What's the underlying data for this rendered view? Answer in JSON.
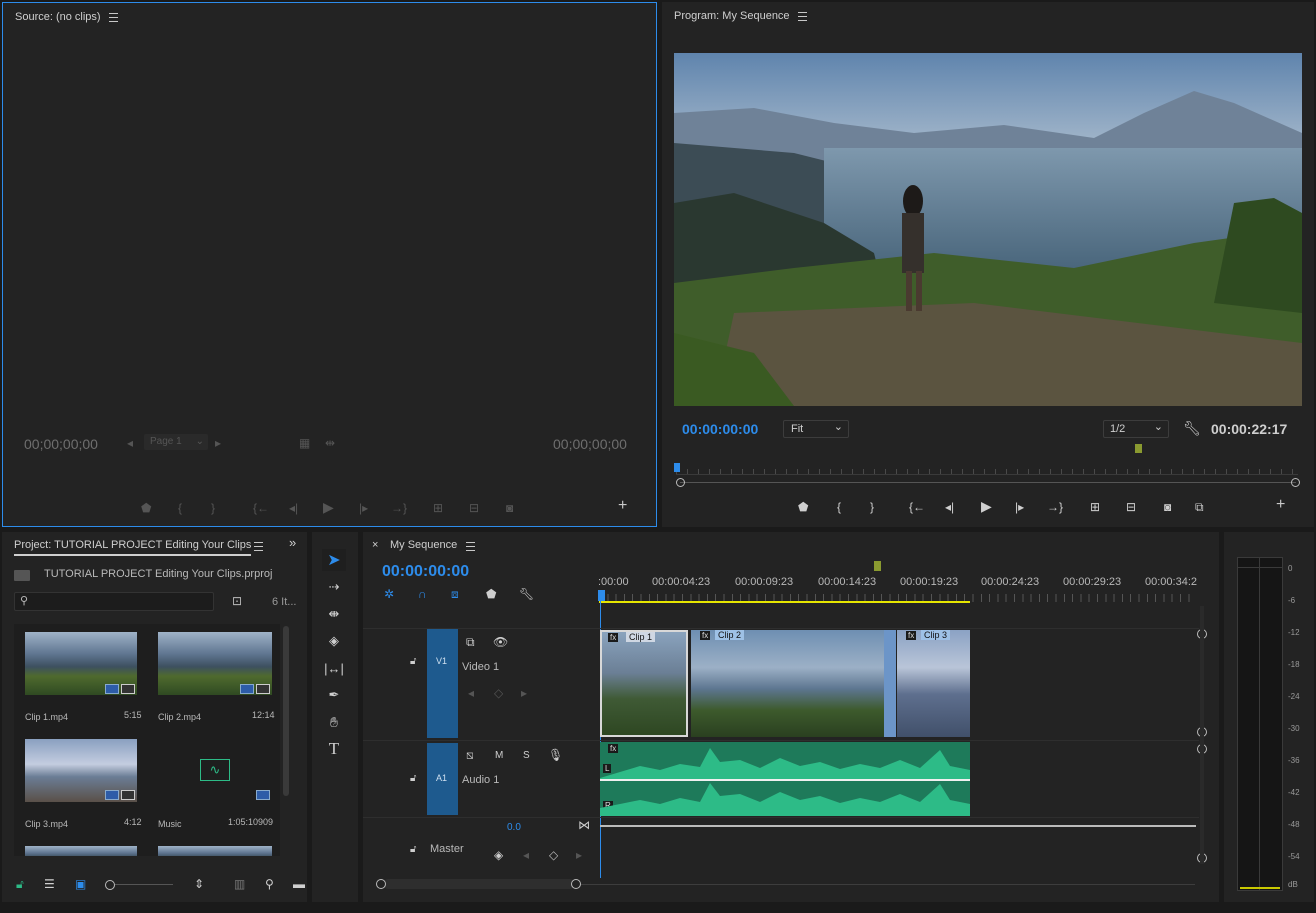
{
  "source_monitor": {
    "title": "Source: (no clips)",
    "timecode_in": "00;00;00;00",
    "timecode_out": "00;00;00;00",
    "page_select": "Page 1"
  },
  "program_monitor": {
    "title": "Program: My Sequence",
    "timecode": "00:00:00:00",
    "fit_select": "Fit",
    "resolution_select": "1/2",
    "duration": "00:00:22:17"
  },
  "project_panel": {
    "title": "Project: TUTORIAL PROJECT Editing Your Clips",
    "file_name": "TUTORIAL PROJECT Editing Your Clips.prproj",
    "item_count": "6 It...",
    "search_placeholder": "",
    "items": [
      {
        "name": "Clip 1.mp4",
        "duration": "5:15"
      },
      {
        "name": "Clip 2.mp4",
        "duration": "12:14"
      },
      {
        "name": "Clip 3.mp4",
        "duration": "4:12"
      },
      {
        "name": "Music",
        "duration": "1:05:10909"
      }
    ]
  },
  "timeline": {
    "tab_title": "My Sequence",
    "close": "×",
    "timecode": "00:00:00:00",
    "ruler_labels": [
      ":00:00",
      "00:00:04:23",
      "00:00:09:23",
      "00:00:14:23",
      "00:00:19:23",
      "00:00:24:23",
      "00:00:29:23",
      "00:00:34:2"
    ],
    "tracks": {
      "v1_label": "V1",
      "v1_name": "Video 1",
      "a1_label": "A1",
      "a1_name": "Audio 1",
      "mute": "M",
      "solo": "S",
      "master_name": "Master",
      "master_value": "0.0",
      "left_channel": "L",
      "right_channel": "R"
    },
    "clips": [
      {
        "name": "Clip 1",
        "fx": "fx"
      },
      {
        "name": "Clip 2",
        "fx": "fx"
      },
      {
        "name": "Clip 3",
        "fx": "fx"
      }
    ],
    "audio_fx": "fx"
  },
  "audio_meter": {
    "labels": [
      "0",
      "-6",
      "-12",
      "-18",
      "-24",
      "-30",
      "-36",
      "-42",
      "-48",
      "-54",
      "dB"
    ]
  },
  "colors": {
    "accent_blue": "#2d8ceb",
    "track_blue": "#1e5a8e",
    "audio_green": "#2dbb87",
    "work_area_yellow": "#e6e600"
  }
}
